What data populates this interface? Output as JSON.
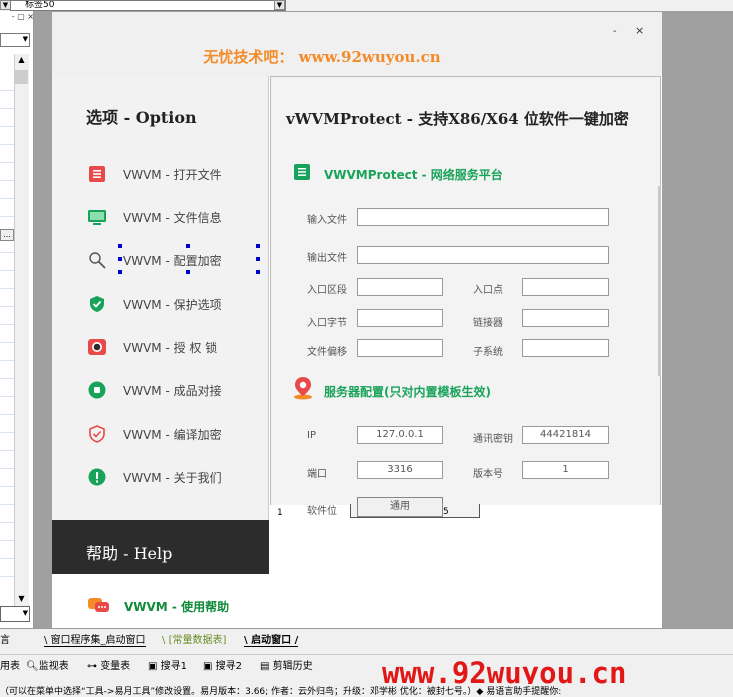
{
  "ide": {
    "tab_combo_value": "标签50",
    "left_panel_btn": "...",
    "bottom_tabs": [
      "窗口程序集_启动窗口",
      "[常量数据表]",
      "启动窗口"
    ],
    "toolbar": [
      "用表",
      "监视表",
      "变量表",
      "搜寻1",
      "搜寻2",
      "剪辑历史"
    ],
    "status_text": "（可以在菜单中选择“工具->易月工具”修改设置。易月版本：3.66; 作者：云外归鸟；升级：邓学彬 优化：被封七号。）◆ 易语言助手提醒你:",
    "watermark": "www.92wuyou.cn"
  },
  "form": {
    "site_title": "无忧技术吧： www.92wuyou.cn",
    "min_label": "-",
    "close_label": "×",
    "sidebar": {
      "title": "选项 - Option",
      "items": [
        {
          "label": "VWVM - 打开文件",
          "icon": "file-list-icon"
        },
        {
          "label": "VWVM - 文件信息",
          "icon": "monitor-icon"
        },
        {
          "label": "VWVM - 配置加密",
          "icon": "magnifier-icon"
        },
        {
          "label": "VWVM - 保护选项",
          "icon": "shield-check-icon"
        },
        {
          "label": "VWVM - 授 权 锁",
          "icon": "camera-icon"
        },
        {
          "label": "VWVM - 成品对接",
          "icon": "square-dot-icon"
        },
        {
          "label": "VWVM - 编译加密",
          "icon": "shield-outline-icon"
        },
        {
          "label": "VWVM - 关于我们",
          "icon": "exclamation-icon"
        }
      ],
      "help_title": "帮助 - Help",
      "help_item": "VWVM - 使用帮助"
    },
    "main": {
      "title": "vWVMProtect - 支持X86/X64 位软件一键加密",
      "section1": "VWVMProtect - 网络服务平台",
      "labels": {
        "input_file": "输入文件",
        "output_file": "输出文件",
        "entry_section": "入口区段",
        "entry_point": "入口点",
        "entry_bytes": "入口字节",
        "linker": "链接器",
        "file_offset": "文件偏移",
        "subsystem": "子系统"
      },
      "section2": "服务器配置(只对内置模板生效)",
      "server": {
        "ip_label": "IP",
        "ip_value": "127.0.0.1",
        "key_label": "通讯密钥",
        "key_value": "44421814",
        "port_label": "端口",
        "port_value": "3316",
        "version_label": "版本号",
        "version_value": "1",
        "software_label": "软件位",
        "software_value": "通用"
      },
      "tab_num_1": "1",
      "tab_num_5": "5"
    }
  },
  "colors": {
    "accent_green": "#19a35a",
    "title_orange": "#f48b2a",
    "help_band": "#2c2c2c",
    "watermark_red": "#e21818"
  }
}
